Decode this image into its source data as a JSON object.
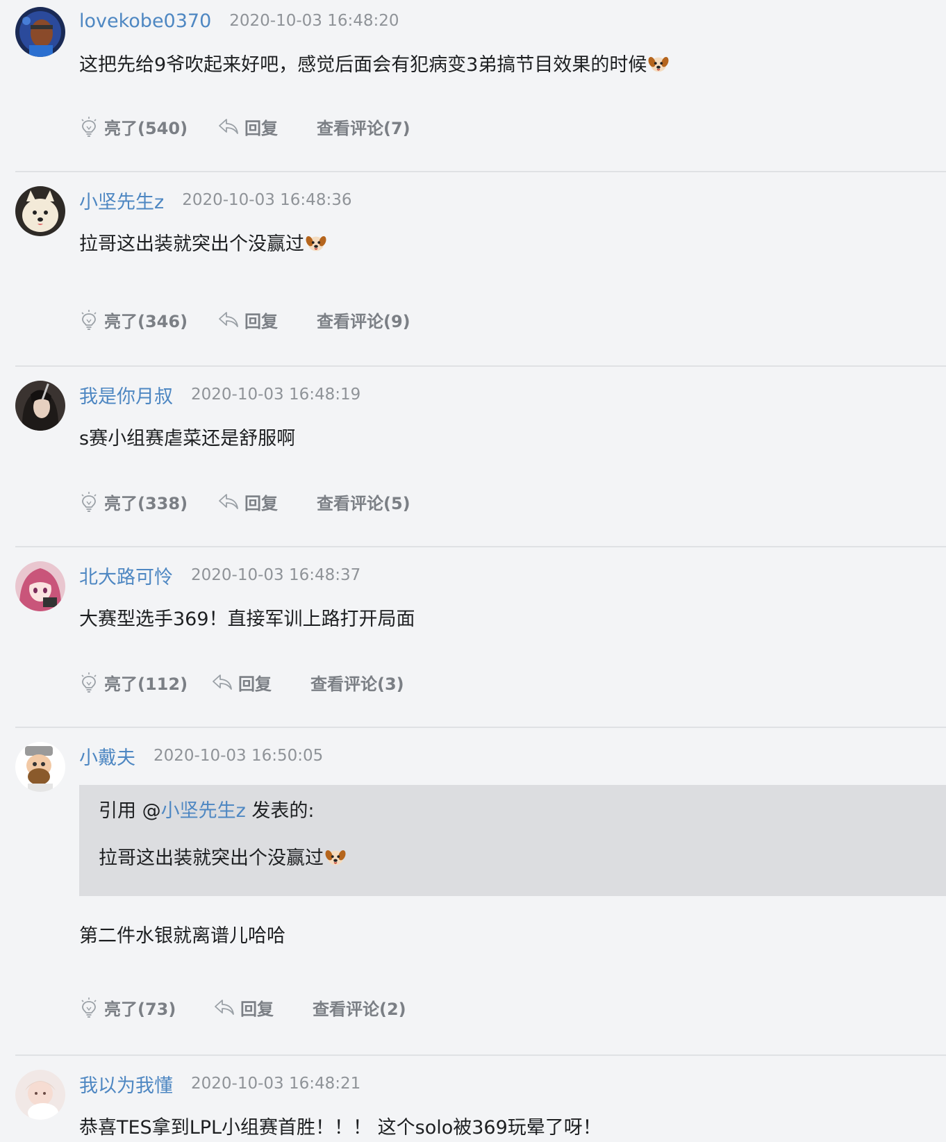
{
  "comments": [
    {
      "user": "lovekobe0370",
      "time": "2020-10-03 16:48:20",
      "text": "这把先给9爷吹起来好吧，感觉后面会有犯病变3弟搞节目效果的时候",
      "like_label": "亮了(540)",
      "reply_label": "回复",
      "view_label": "查看评论(7)"
    },
    {
      "user": "小坚先生z",
      "time": "2020-10-03 16:48:36",
      "text": "拉哥这出装就突出个没赢过",
      "like_label": "亮了(346)",
      "reply_label": "回复",
      "view_label": "查看评论(9)"
    },
    {
      "user": "我是你月叔",
      "time": "2020-10-03 16:48:19",
      "text": "s赛小组赛虐菜还是舒服啊",
      "like_label": "亮了(338)",
      "reply_label": "回复",
      "view_label": "查看评论(5)"
    },
    {
      "user": "北大路可怜",
      "time": "2020-10-03 16:48:37",
      "text": "大赛型选手369！直接军训上路打开局面",
      "like_label": "亮了(112)",
      "reply_label": "回复",
      "view_label": "查看评论(3)"
    },
    {
      "user": "小戴夫",
      "time": "2020-10-03 16:50:05",
      "quote": {
        "prefix": "引用 @",
        "name": "小坚先生z",
        "suffix": " 发表的:",
        "text": "拉哥这出装就突出个没赢过"
      },
      "text": "第二件水银就离谱儿哈哈",
      "like_label": "亮了(73)",
      "reply_label": "回复",
      "view_label": "查看评论(2)"
    },
    {
      "user": "我以为我懂",
      "time": "2020-10-03 16:48:21",
      "text": "恭喜TES拿到LPL小组赛首胜！！！ 这个solo被369玩晕了呀！"
    }
  ],
  "icons": {
    "like": "lightbulb-icon",
    "reply": "reply-arrow-icon",
    "emoji": "dog-face-emoji"
  },
  "colors": {
    "background": "#f3f4f6",
    "username": "#4e87c2",
    "timestamp": "#8f9398",
    "body_text": "#1d1f21",
    "action_text": "#7b7f85",
    "quote_bg": "#dcdde0",
    "divider": "#dfe1e4"
  }
}
